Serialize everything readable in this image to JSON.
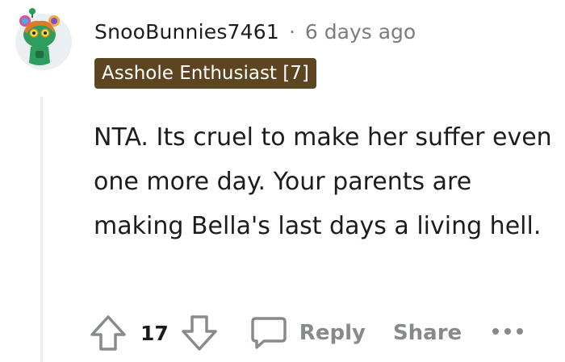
{
  "comment": {
    "username": "SnooBunnies7461",
    "separator": "·",
    "time": "6 days ago",
    "flair": "Asshole Enthusiast [7]",
    "body": "NTA. Its cruel to make her suffer even one more day. Your parents are making Bella's last days a living hell."
  },
  "actions": {
    "score": "17",
    "reply_label": "Reply",
    "share_label": "Share"
  },
  "icons": {
    "upvote": "arrow-up-icon",
    "downvote": "arrow-down-icon",
    "reply": "speech-bubble-icon",
    "more": "ellipsis-icon"
  },
  "colors": {
    "flair_bg": "#5c4520",
    "muted": "#878a8c",
    "avatar_bg": "#eceff1"
  }
}
